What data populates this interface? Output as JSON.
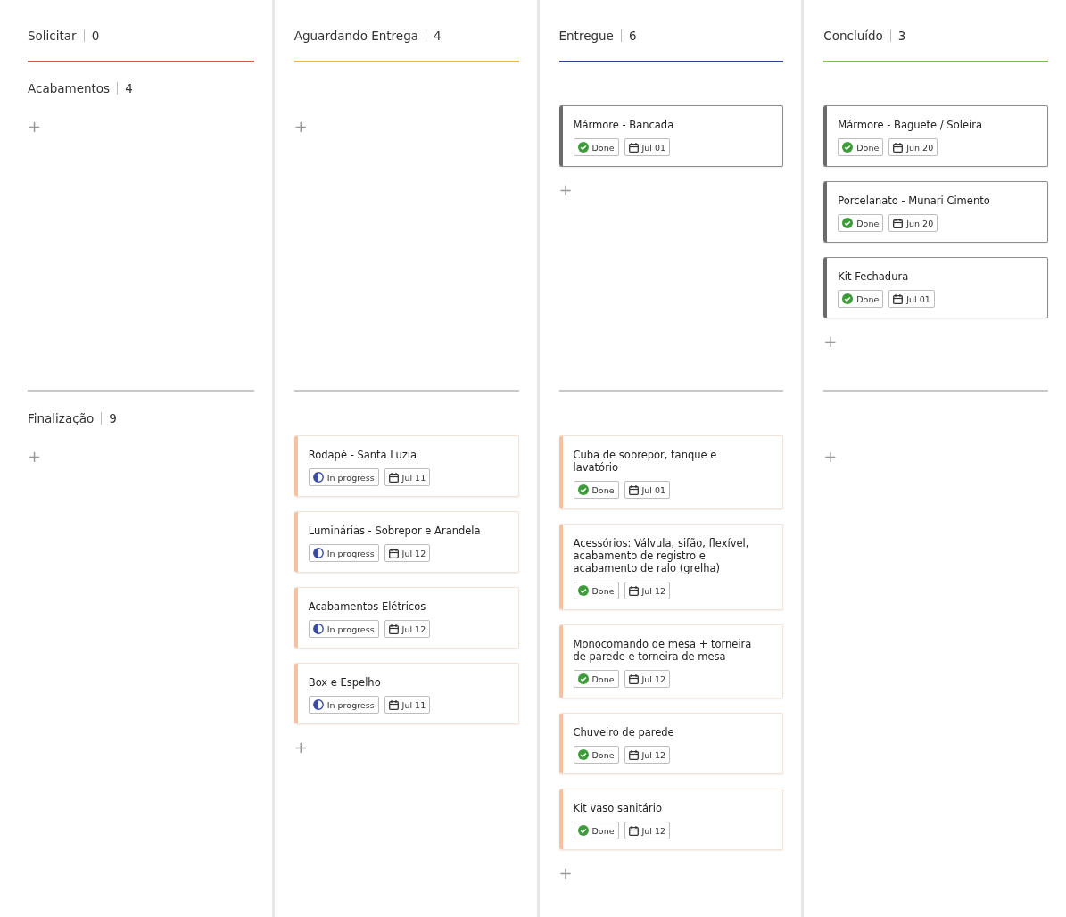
{
  "columns": [
    {
      "title": "Solicitar",
      "count": "0",
      "color": "#d0583c"
    },
    {
      "title": "Aguardando Entrega",
      "count": "4",
      "color": "#e6b83a"
    },
    {
      "title": "Entregue",
      "count": "6",
      "color": "#2b3f98"
    },
    {
      "title": "Concluído",
      "count": "3",
      "color": "#7dbd4c"
    }
  ],
  "lanes": [
    {
      "title": "Acabamentos",
      "count": "4",
      "color": "#6b6b6b",
      "cells": [
        {
          "add": "+"
        },
        {
          "add": "+"
        },
        {
          "add": "+",
          "cards": [
            {
              "title": "Mármore - Bancada",
              "status": {
                "kind": "done",
                "label": "Done"
              },
              "date": "Jul 01"
            }
          ]
        },
        {
          "add": "+",
          "cards": [
            {
              "title": "Mármore -  Baguete / Soleira",
              "status": {
                "kind": "done",
                "label": "Done"
              },
              "date": "Jun 20"
            },
            {
              "title": "Porcelanato - Munari Cimento",
              "status": {
                "kind": "done",
                "label": "Done"
              },
              "date": "Jun 20"
            },
            {
              "title": "Kit Fechadura",
              "status": {
                "kind": "done",
                "label": "Done"
              },
              "date": "Jul 01"
            }
          ]
        }
      ]
    },
    {
      "title": "Finalização",
      "count": "9",
      "color": "#f2c2a2",
      "cells": [
        {
          "add": "+"
        },
        {
          "add": "+",
          "cards": [
            {
              "title": "Rodapé - Santa Luzia",
              "status": {
                "kind": "in_progress",
                "label": "In progress"
              },
              "date": "Jul 11"
            },
            {
              "title": "Luminárias - Sobrepor e Arandela",
              "status": {
                "kind": "in_progress",
                "label": "In progress"
              },
              "date": "Jul 12"
            },
            {
              "title": "Acabamentos Elétricos",
              "status": {
                "kind": "in_progress",
                "label": "In progress"
              },
              "date": "Jul 12"
            },
            {
              "title": "Box e Espelho",
              "status": {
                "kind": "in_progress",
                "label": "In progress"
              },
              "date": "Jul 11"
            }
          ]
        },
        {
          "add": "+",
          "cards": [
            {
              "title": "Cuba de sobrepor, tanque e lavatório",
              "status": {
                "kind": "done",
                "label": "Done"
              },
              "date": "Jul 01"
            },
            {
              "title": "Acessórios: Válvula, sifão, flexível, acabamento de registro e acabamento de ralo (grelha)",
              "status": {
                "kind": "done",
                "label": "Done"
              },
              "date": "Jul 12"
            },
            {
              "title": "Monocomando de mesa + torneira de parede e torneira de mesa",
              "status": {
                "kind": "done",
                "label": "Done"
              },
              "date": "Jul 12"
            },
            {
              "title": "Chuveiro de parede",
              "status": {
                "kind": "done",
                "label": "Done"
              },
              "date": "Jul 12"
            },
            {
              "title": "Kit vaso sanitário",
              "status": {
                "kind": "done",
                "label": "Done"
              },
              "date": "Jul 12"
            }
          ]
        },
        {
          "add": "+"
        }
      ]
    }
  ]
}
